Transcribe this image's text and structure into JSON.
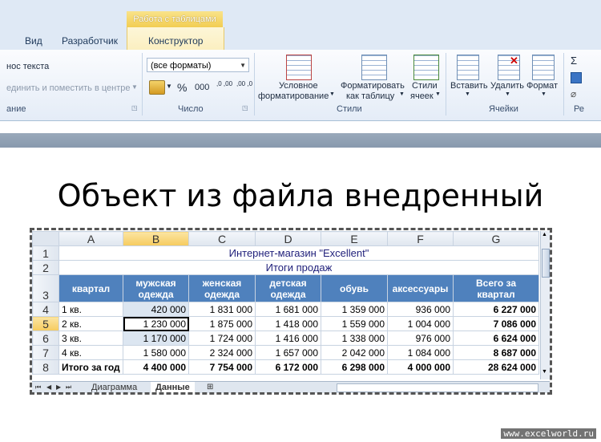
{
  "ribbon": {
    "context_header": "Работа с таблицами",
    "tabs": [
      "Вид",
      "Разработчик",
      "Конструктор"
    ],
    "alignment": {
      "wrap_text": "нос текста",
      "merge_center": "единить и поместить в центре",
      "group_label": "ание"
    },
    "number": {
      "format_value": "(все форматы)",
      "percent": "%",
      "thousands": "000",
      "inc_decimal": ",0 ,00",
      "dec_decimal": ",00 ,0",
      "group_label": "Число"
    },
    "styles": {
      "conditional_label_1": "Условное",
      "conditional_label_2": "форматирование",
      "format_table_1": "Форматировать",
      "format_table_2": "как таблицу",
      "cell_styles_1": "Стили",
      "cell_styles_2": "ячеек",
      "group_label": "Стили"
    },
    "cells": {
      "insert": "Вставить",
      "delete": "Удалить",
      "format": "Формат",
      "group_label": "Ячейки"
    },
    "editing": {
      "sum": "Σ",
      "label": "Ре"
    }
  },
  "slide_title": "Объект из файла внедренный",
  "sheet": {
    "columns": [
      "A",
      "B",
      "C",
      "D",
      "E",
      "F",
      "G"
    ],
    "rows": [
      "1",
      "2",
      "3",
      "4",
      "5",
      "6",
      "7",
      "8"
    ],
    "title_row": "Интернет-магазин \"Excellent\"",
    "subtitle_row": "Итоги продаж",
    "headers": [
      "квартал",
      "мужская одежда",
      "женская одежда",
      "детская одежда",
      "обувь",
      "аксессуары",
      "Всего за квартал"
    ],
    "data": [
      [
        "1 кв.",
        "420 000",
        "1 831 000",
        "1 681 000",
        "1 359 000",
        "936 000",
        "6 227 000"
      ],
      [
        "2 кв.",
        "1 230 000",
        "1 875 000",
        "1 418 000",
        "1 559 000",
        "1 004 000",
        "7 086 000"
      ],
      [
        "3 кв.",
        "1 170 000",
        "1 724 000",
        "1 416 000",
        "1 338 000",
        "976 000",
        "6 624 000"
      ],
      [
        "4 кв.",
        "1 580 000",
        "2 324 000",
        "1 657 000",
        "2 042 000",
        "1 084 000",
        "8 687 000"
      ],
      [
        "Итого за год",
        "4 400 000",
        "7 754 000",
        "6 172 000",
        "6 298 000",
        "4 000 000",
        "28 624 000"
      ]
    ],
    "sheet_tabs": [
      "Диаграмма",
      "Данные"
    ],
    "active_tab": "Данные"
  },
  "watermark": "www.excelworld.ru"
}
